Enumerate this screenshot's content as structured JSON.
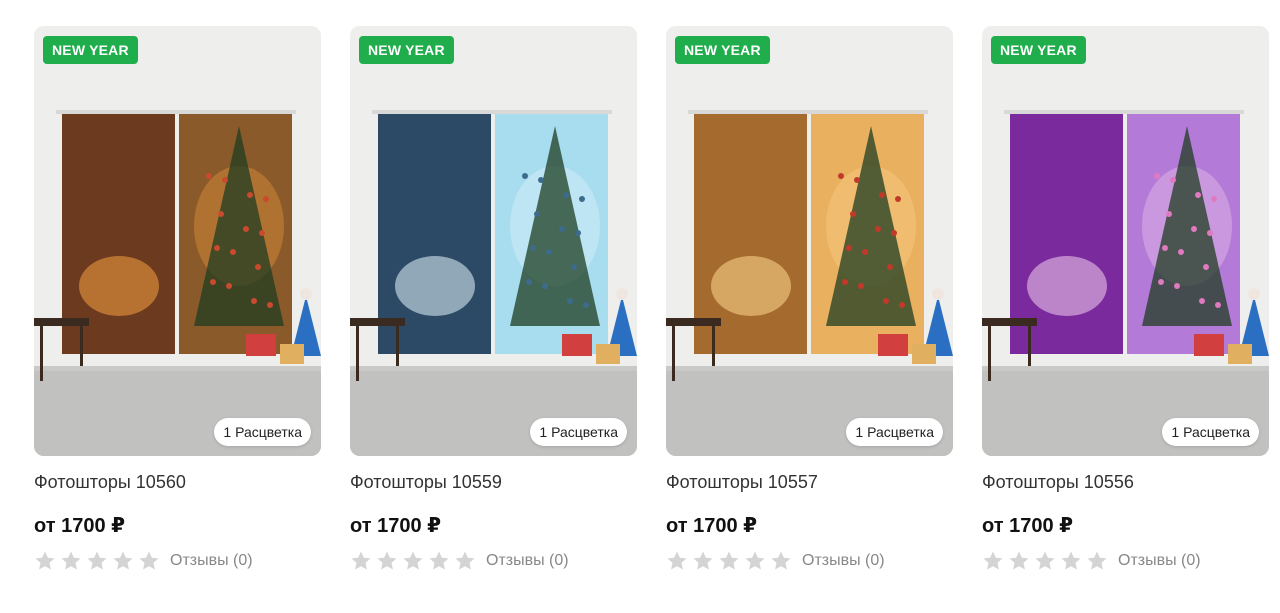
{
  "products": [
    {
      "badge": "NEW YEAR",
      "variants": "1 Расцветка",
      "title": "Фотошторы 10560",
      "price": "от 1700 ₽",
      "reviews": "Отзывы (0)",
      "stars_filled": 0,
      "palette": {
        "left": "#6b3a1f",
        "right": "#8a5a2a",
        "accent": "#c94a2e",
        "glow": "#f5a040"
      }
    },
    {
      "badge": "NEW YEAR",
      "variants": "1 Расцветка",
      "title": "Фотошторы 10559",
      "price": "от 1700 ₽",
      "reviews": "Отзывы (0)",
      "stars_filled": 0,
      "palette": {
        "left": "#2c4a66",
        "right": "#a8dcef",
        "accent": "#3d6b8c",
        "glow": "#e6f6fb"
      }
    },
    {
      "badge": "NEW YEAR",
      "variants": "1 Расцветка",
      "title": "Фотошторы 10557",
      "price": "от 1700 ₽",
      "reviews": "Отзывы (0)",
      "stars_filled": 0,
      "palette": {
        "left": "#a56a2e",
        "right": "#e9b060",
        "accent": "#c0392b",
        "glow": "#ffd890"
      }
    },
    {
      "badge": "NEW YEAR",
      "variants": "1 Расцветка",
      "title": "Фотошторы 10556",
      "price": "от 1700 ₽",
      "reviews": "Отзывы (0)",
      "stars_filled": 0,
      "palette": {
        "left": "#7a2a9c",
        "right": "#b47ad8",
        "accent": "#e07ac0",
        "glow": "#f3d0ef"
      }
    }
  ],
  "colors": {
    "badge": "#1fae4b",
    "star_empty": "#d4d4d4",
    "star_filled": "#f5b400"
  }
}
